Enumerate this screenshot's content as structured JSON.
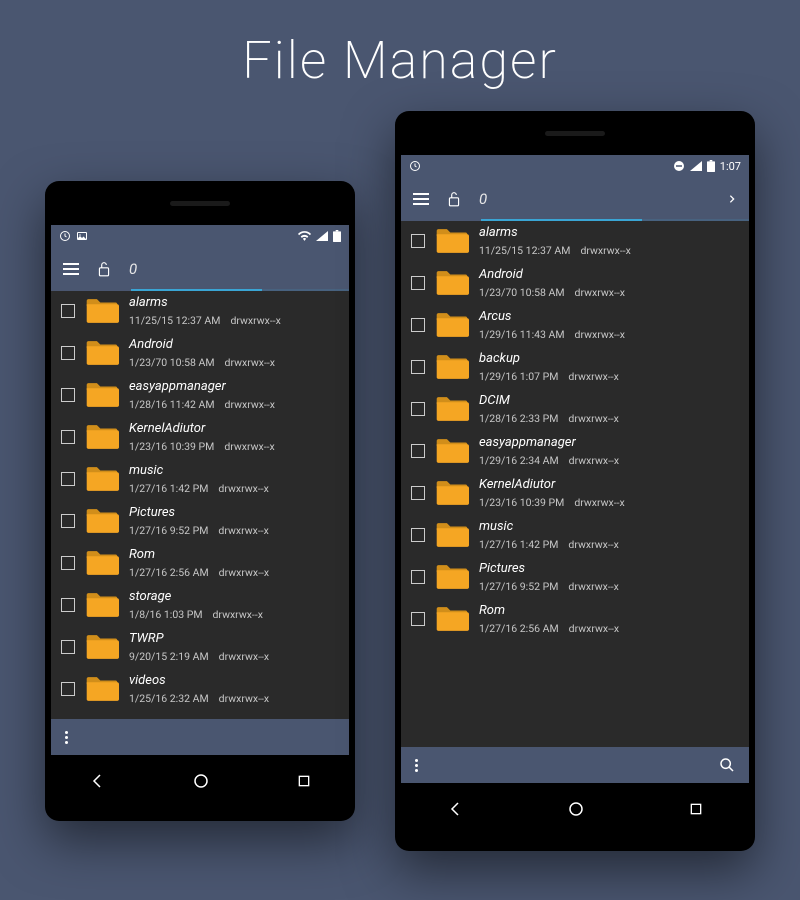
{
  "title": "File Manager",
  "colors": {
    "bg": "#4a5670",
    "folder": "#f5a623",
    "accent": "#3aa5d4"
  },
  "phones": {
    "small": {
      "status": {
        "time": ""
      },
      "header": {
        "path": "0"
      },
      "files": [
        {
          "name": "alarms",
          "date": "11/25/15 12:37 AM",
          "perms": "drwxrwx--x"
        },
        {
          "name": "Android",
          "date": "1/23/70 10:58 AM",
          "perms": "drwxrwx--x"
        },
        {
          "name": "easyappmanager",
          "date": "1/28/16 11:42 AM",
          "perms": "drwxrwx--x"
        },
        {
          "name": "KernelAdiutor",
          "date": "1/23/16 10:39 PM",
          "perms": "drwxrwx--x"
        },
        {
          "name": "music",
          "date": "1/27/16 1:42 PM",
          "perms": "drwxrwx--x"
        },
        {
          "name": "Pictures",
          "date": "1/27/16 9:52 PM",
          "perms": "drwxrwx--x"
        },
        {
          "name": "Rom",
          "date": "1/27/16 2:56 AM",
          "perms": "drwxrwx--x"
        },
        {
          "name": "storage",
          "date": "1/8/16 1:03 PM",
          "perms": "drwxrwx--x"
        },
        {
          "name": "TWRP",
          "date": "9/20/15 2:19 AM",
          "perms": "drwxrwx--x"
        },
        {
          "name": "videos",
          "date": "1/25/16 2:32 AM",
          "perms": "drwxrwx--x"
        }
      ]
    },
    "large": {
      "status": {
        "time": "1:07"
      },
      "header": {
        "path": "0"
      },
      "files": [
        {
          "name": "alarms",
          "date": "11/25/15 12:37 AM",
          "perms": "drwxrwx--x"
        },
        {
          "name": "Android",
          "date": "1/23/70 10:58 AM",
          "perms": "drwxrwx--x"
        },
        {
          "name": "Arcus",
          "date": "1/29/16 11:43 AM",
          "perms": "drwxrwx--x"
        },
        {
          "name": "backup",
          "date": "1/29/16 1:07 PM",
          "perms": "drwxrwx--x"
        },
        {
          "name": "DCIM",
          "date": "1/28/16 2:33 PM",
          "perms": "drwxrwx--x"
        },
        {
          "name": "easyappmanager",
          "date": "1/29/16 2:34 AM",
          "perms": "drwxrwx--x"
        },
        {
          "name": "KernelAdiutor",
          "date": "1/23/16 10:39 PM",
          "perms": "drwxrwx--x"
        },
        {
          "name": "music",
          "date": "1/27/16 1:42 PM",
          "perms": "drwxrwx--x"
        },
        {
          "name": "Pictures",
          "date": "1/27/16 9:52 PM",
          "perms": "drwxrwx--x"
        },
        {
          "name": "Rom",
          "date": "1/27/16 2:56 AM",
          "perms": "drwxrwx--x"
        }
      ]
    }
  }
}
